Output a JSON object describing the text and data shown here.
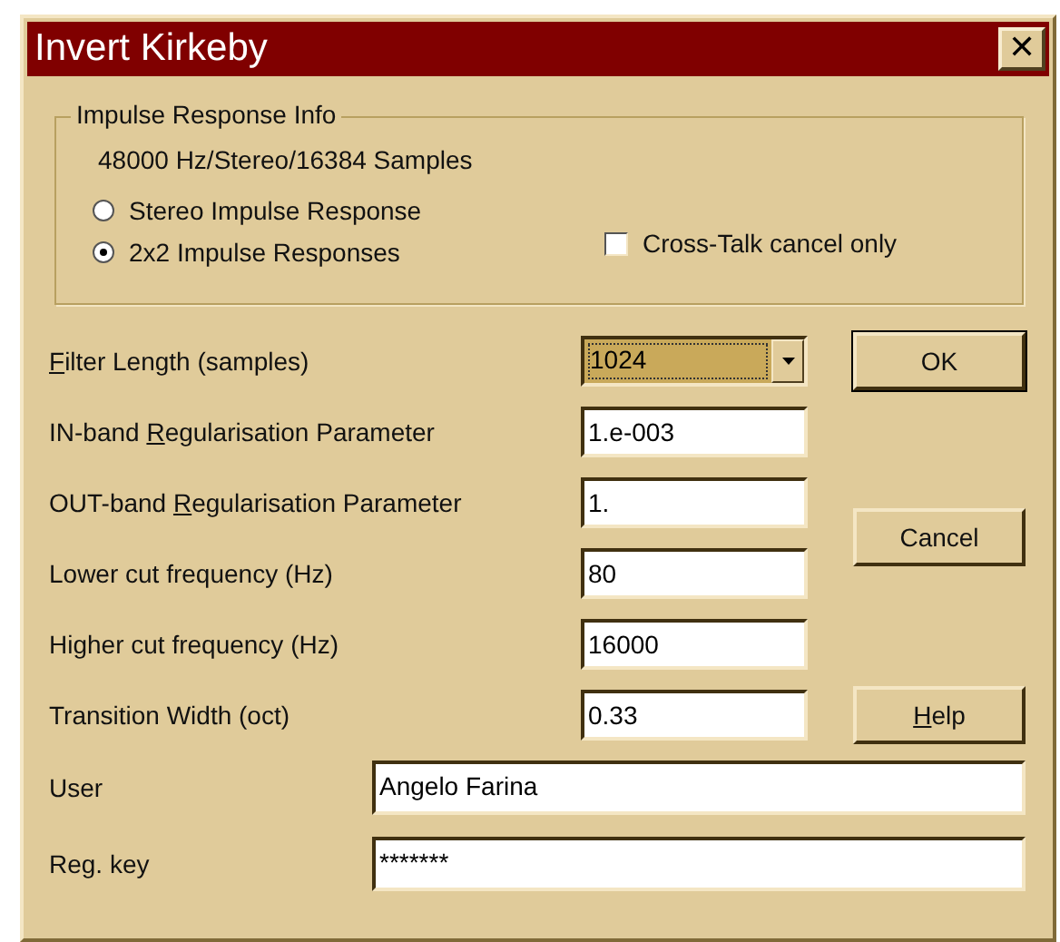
{
  "window": {
    "title": "Invert Kirkeby",
    "close": "✕"
  },
  "group": {
    "title": "Impulse Response Info",
    "info": "48000 Hz/Stereo/16384 Samples",
    "radios": [
      {
        "label": "Stereo Impulse Response",
        "selected": false
      },
      {
        "label": "2x2 Impulse Responses",
        "selected": true
      }
    ],
    "checkbox": {
      "label": "Cross-Talk cancel only",
      "checked": false
    }
  },
  "params": [
    {
      "kind": "combo",
      "label": {
        "key": "F",
        "post": "ilter Length (samples)"
      },
      "value": "1024",
      "focused": true
    },
    {
      "kind": "edit",
      "label": {
        "pre": "IN-band ",
        "key": "R",
        "post": "egularisation Parameter"
      },
      "value": "1.e-003"
    },
    {
      "kind": "edit",
      "label": {
        "pre": "OUT-band ",
        "key": "R",
        "post": "egularisation Parameter"
      },
      "value": "1."
    },
    {
      "kind": "edit",
      "label": {
        "pre": "Lower cut frequency (Hz)"
      },
      "value": "80"
    },
    {
      "kind": "edit",
      "label": {
        "pre": "Higher cut frequency (Hz)"
      },
      "value": "16000"
    },
    {
      "kind": "edit",
      "label": {
        "pre": "Transition Width (oct)"
      },
      "value": "0.33"
    }
  ],
  "buttons": [
    {
      "pre": "OK",
      "default": true
    },
    {
      "pre": "Cancel",
      "default": false
    },
    {
      "key": "H",
      "post": "elp",
      "default": false
    }
  ],
  "user": {
    "label": "User",
    "value": "Angelo Farina"
  },
  "reg": {
    "label": "Reg. key",
    "value": "*******"
  }
}
